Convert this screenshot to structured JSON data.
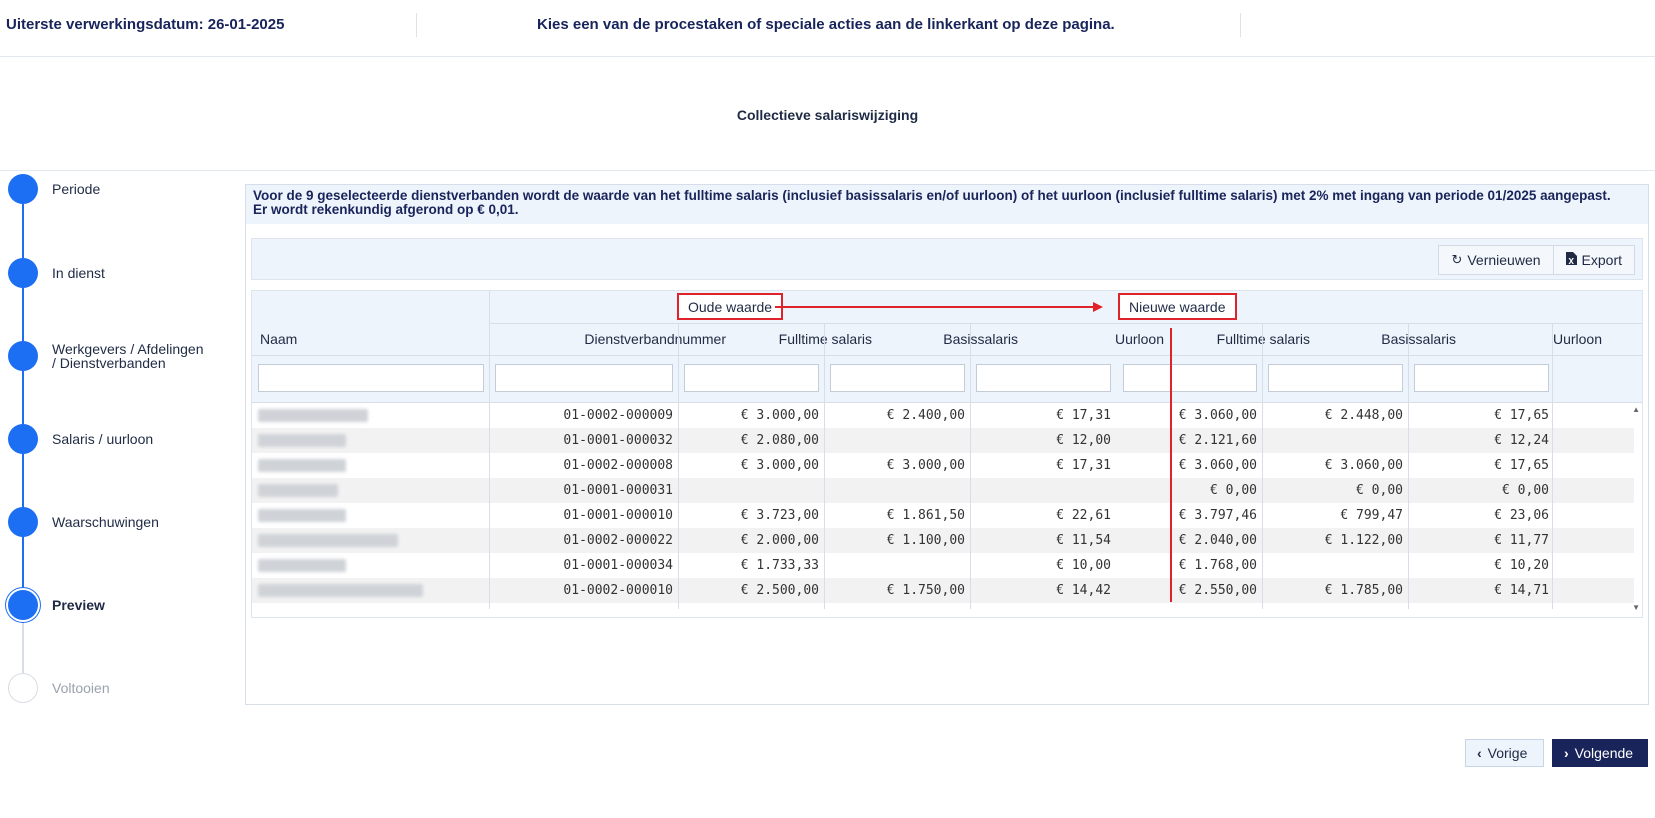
{
  "header": {
    "deadline": "Uiterste verwerkingsdatum: 26-01-2025",
    "message": "Kies een van de procestaken of speciale acties aan de linkerkant op deze pagina."
  },
  "page_title": "Collectieve salariswijziging",
  "stepper": {
    "steps": [
      {
        "label": "Periode",
        "state": "done"
      },
      {
        "label": "In dienst",
        "state": "done"
      },
      {
        "label": "Werkgevers / Afdelingen / Dienstverbanden",
        "line1": "Werkgevers / Afdelingen",
        "line2": "/ Dienstverbanden",
        "state": "done"
      },
      {
        "label": "Salaris / uurloon",
        "state": "done"
      },
      {
        "label": "Waarschuwingen",
        "state": "done"
      },
      {
        "label": "Preview",
        "state": "active"
      },
      {
        "label": "Voltooien",
        "state": "pending"
      }
    ]
  },
  "notice": {
    "line1": "Voor de 9 geselecteerde dienstverbanden wordt de waarde van het fulltime salaris (inclusief basissalaris en/of uurloon) of het uurloon (inclusief fulltime salaris) met 2% met ingang van periode 01/2025 aangepast.",
    "line2": "Er wordt rekenkundig afgerond op € 0,01."
  },
  "toolbar": {
    "refresh_label": "Vernieuwen",
    "export_label": "Export"
  },
  "grid": {
    "group_old": "Oude waarde",
    "group_new": "Nieuwe waarde",
    "columns": [
      "Naam",
      "Dienstverbandnummer",
      "Fulltime salaris",
      "Basissalaris",
      "Uurloon",
      "Fulltime salaris",
      "Basissalaris",
      "Uurloon"
    ],
    "rows": [
      {
        "nummer": "01-0002-000009",
        "old_ft": "€ 3.000,00",
        "old_basis": "€ 2.400,00",
        "old_uur": "€ 17,31",
        "new_ft": "€ 3.060,00",
        "new_basis": "€ 2.448,00",
        "new_uur": "€ 17,65"
      },
      {
        "nummer": "01-0001-000032",
        "old_ft": "€ 2.080,00",
        "old_basis": "",
        "old_uur": "€ 12,00",
        "new_ft": "€ 2.121,60",
        "new_basis": "",
        "new_uur": "€ 12,24"
      },
      {
        "nummer": "01-0002-000008",
        "old_ft": "€ 3.000,00",
        "old_basis": "€ 3.000,00",
        "old_uur": "€ 17,31",
        "new_ft": "€ 3.060,00",
        "new_basis": "€ 3.060,00",
        "new_uur": "€ 17,65"
      },
      {
        "nummer": "01-0001-000031",
        "old_ft": "",
        "old_basis": "",
        "old_uur": "",
        "new_ft": "€ 0,00",
        "new_basis": "€ 0,00",
        "new_uur": "€ 0,00"
      },
      {
        "nummer": "01-0001-000010",
        "old_ft": "€ 3.723,00",
        "old_basis": "€ 1.861,50",
        "old_uur": "€ 22,61",
        "new_ft": "€ 3.797,46",
        "new_basis": "€ 799,47",
        "new_uur": "€ 23,06"
      },
      {
        "nummer": "01-0002-000022",
        "old_ft": "€ 2.000,00",
        "old_basis": "€ 1.100,00",
        "old_uur": "€ 11,54",
        "new_ft": "€ 2.040,00",
        "new_basis": "€ 1.122,00",
        "new_uur": "€ 11,77"
      },
      {
        "nummer": "01-0001-000034",
        "old_ft": "€ 1.733,33",
        "old_basis": "",
        "old_uur": "€ 10,00",
        "new_ft": "€ 1.768,00",
        "new_basis": "",
        "new_uur": "€ 10,20"
      },
      {
        "nummer": "01-0002-000010",
        "old_ft": "€ 2.500,00",
        "old_basis": "€ 1.750,00",
        "old_uur": "€ 14,42",
        "new_ft": "€ 2.550,00",
        "new_basis": "€ 1.785,00",
        "new_uur": "€ 14,71"
      }
    ]
  },
  "nav": {
    "prev_label": "Vorige",
    "next_label": "Volgende"
  },
  "colors": {
    "accent": "#1c6ef2",
    "navy": "#18245a",
    "annotation_red": "#e0222b"
  }
}
